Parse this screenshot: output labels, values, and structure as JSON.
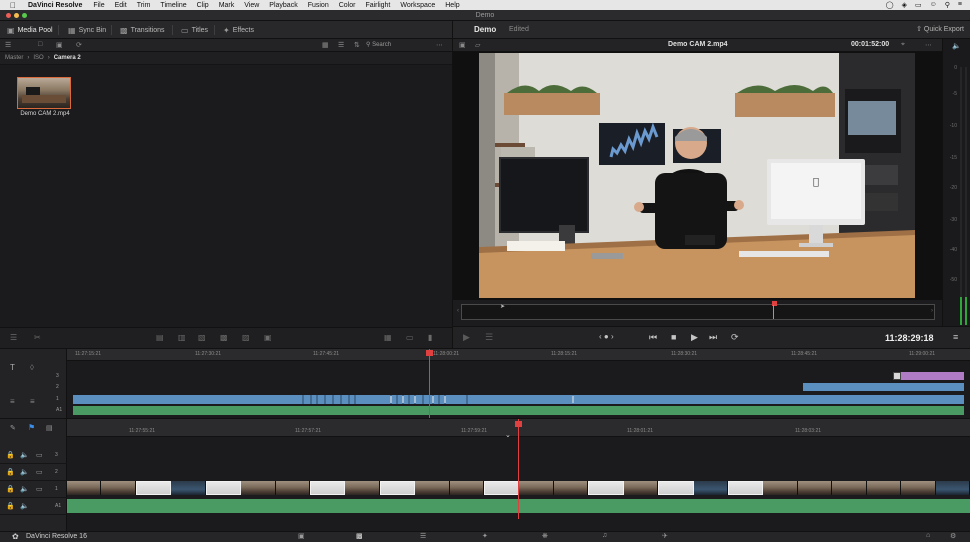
{
  "menubar": {
    "app": "DaVinci Resolve",
    "items": [
      "File",
      "Edit",
      "Trim",
      "Timeline",
      "Clip",
      "Mark",
      "View",
      "Playback",
      "Fusion",
      "Color",
      "Fairlight",
      "Workspace",
      "Help"
    ]
  },
  "window": {
    "title": "Demo"
  },
  "toolbar": {
    "media_pool": "Media Pool",
    "sync_bin": "Sync Bin",
    "transitions": "Transitions",
    "titles": "Titles",
    "effects": "Effects",
    "quick_export": "Quick Export"
  },
  "pool": {
    "search": "Search",
    "breadcrumb": [
      "Master",
      "ISO",
      "Camera 2"
    ],
    "clip_name": "Demo  CAM 2.mp4"
  },
  "viewer": {
    "title": "Demo",
    "status": "Edited",
    "clip": "Demo  CAM 2.mp4",
    "duration": "00:01:52:00",
    "timecode": "11:28:29:18"
  },
  "meters": {
    "ticks": [
      "0",
      "-5",
      "-10",
      "-15",
      "-20",
      "-30",
      "-40",
      "-50"
    ]
  },
  "upper_timeline": {
    "ticks": [
      "11:27:15:21",
      "11:27:30:21",
      "11:27:45:21",
      "11:28:00:21",
      "11:28:15:21",
      "11:28:30:21",
      "11:28:45:21",
      "11:29:00:21"
    ],
    "tracks": [
      "3",
      "2",
      "1",
      "A1"
    ]
  },
  "lower_timeline": {
    "ticks": [
      "11:27:55:21",
      "11:27:57:21",
      "11:27:59:21",
      "11:28:01:21",
      "11:28:03:21"
    ],
    "tracks": [
      "3",
      "2",
      "1",
      "A1"
    ]
  },
  "pagebar": {
    "label": "DaVinci Resolve 16"
  },
  "colors": {
    "video": "#5b8fc0",
    "audio": "#4a9a63",
    "title": "#b07cc6",
    "playhead": "#e04040"
  }
}
